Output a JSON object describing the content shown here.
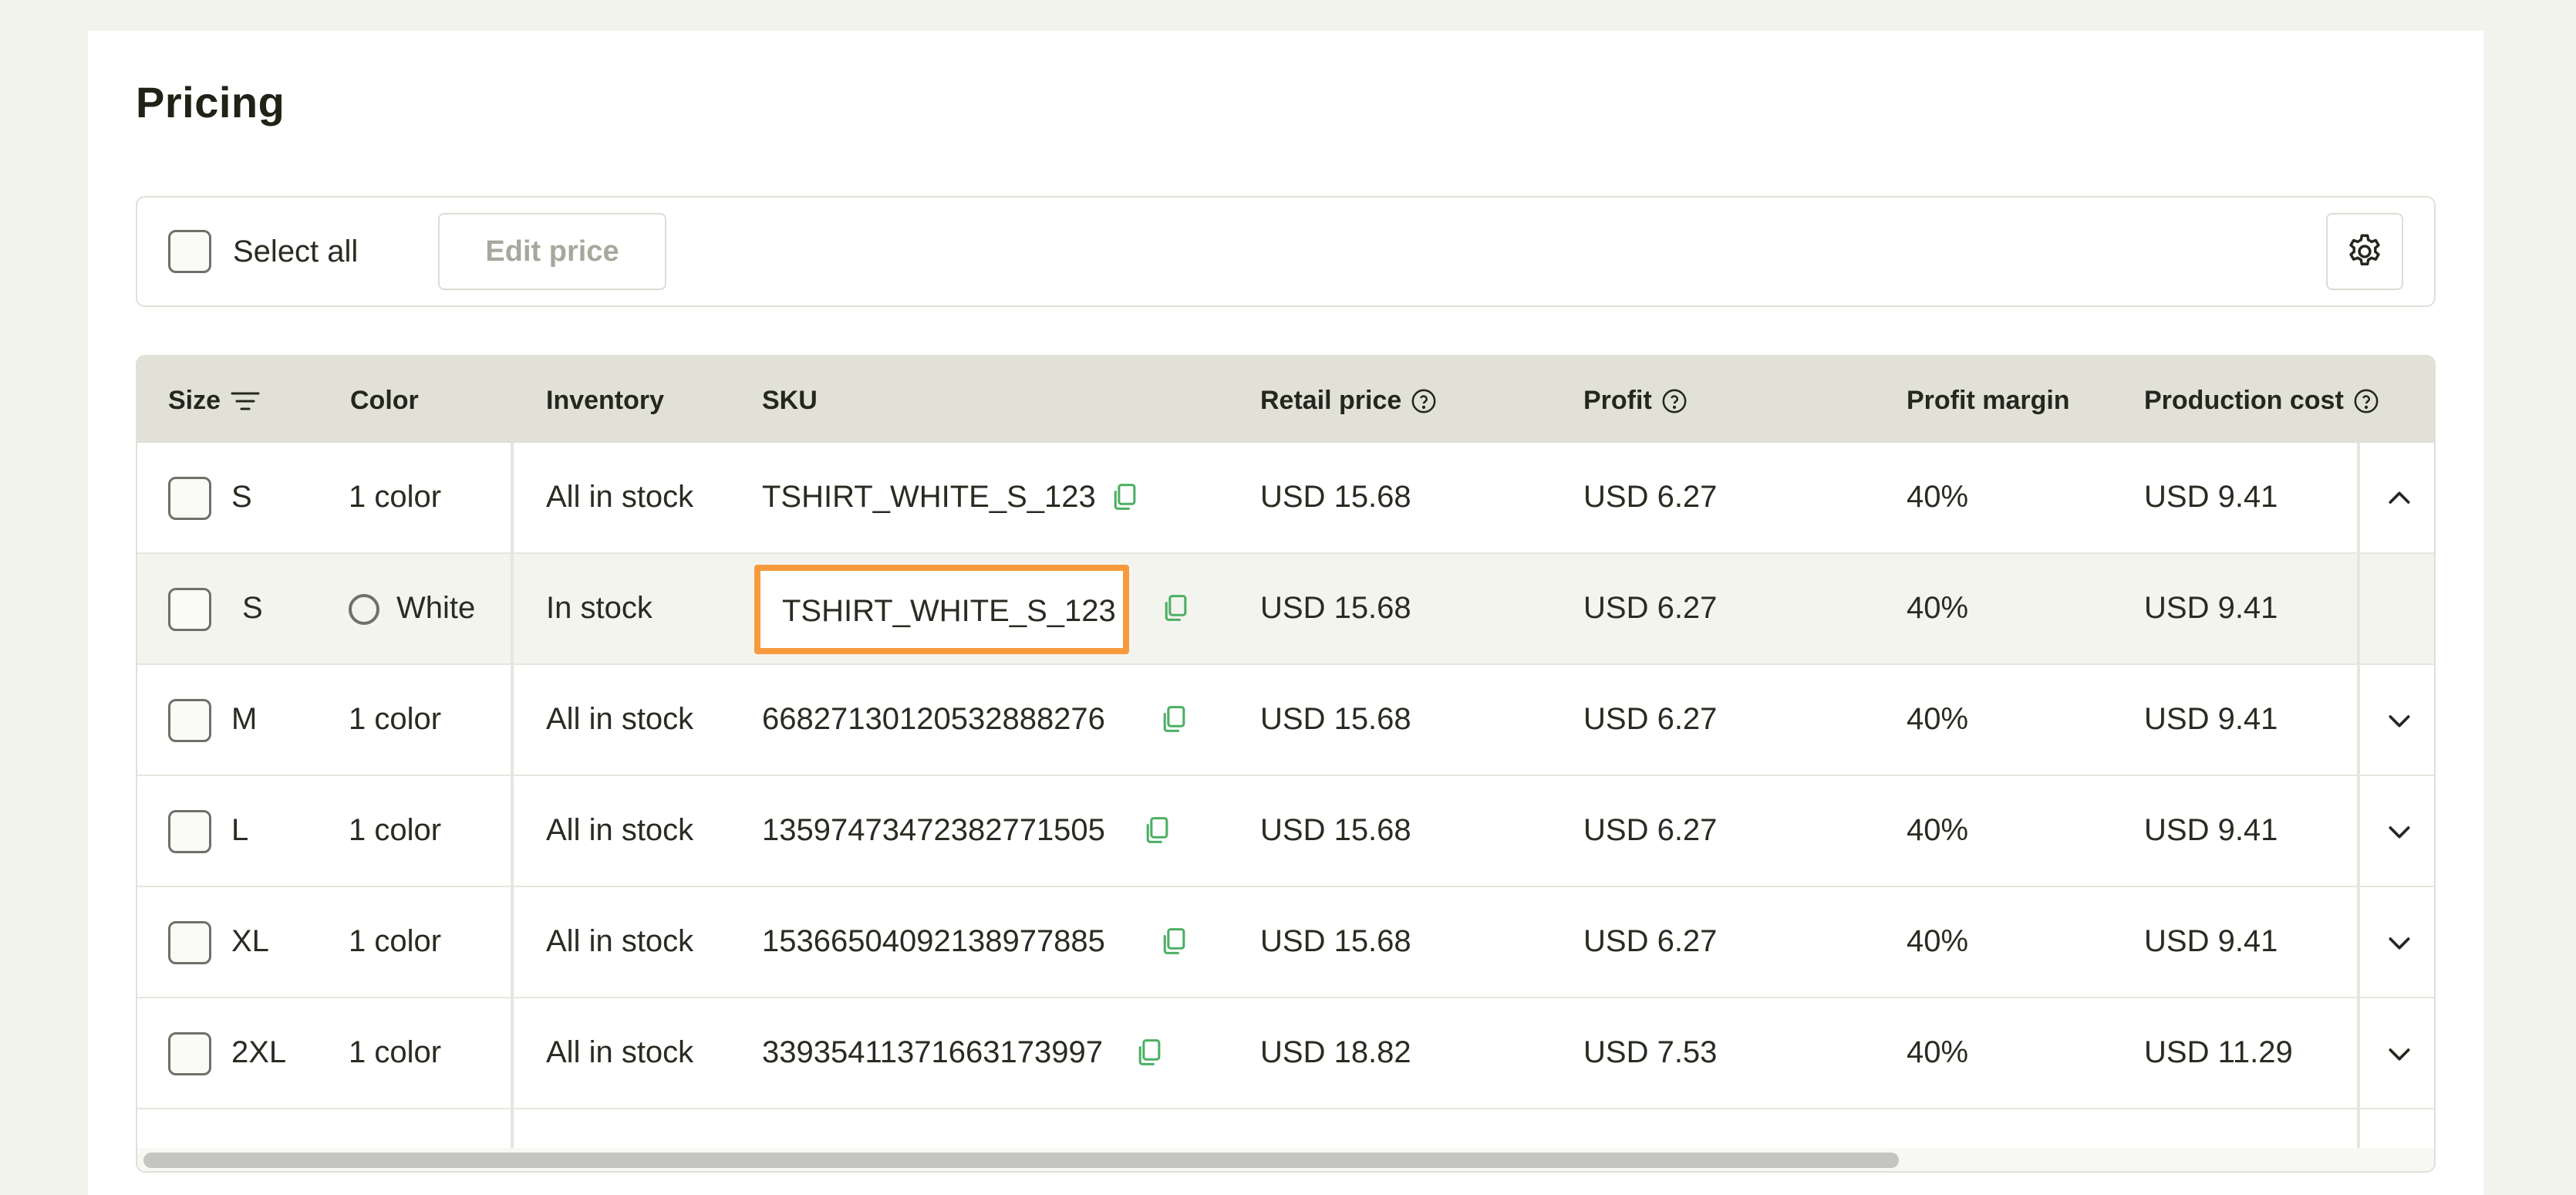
{
  "page": {
    "title": "Pricing"
  },
  "toolbar": {
    "select_all_label": "Select all",
    "edit_price_label": "Edit price",
    "settings_icon": "gear-icon"
  },
  "table": {
    "headers": {
      "size": "Size",
      "color": "Color",
      "inventory": "Inventory",
      "sku": "SKU",
      "retail_price": "Retail price",
      "profit": "Profit",
      "profit_margin": "Profit margin",
      "production_cost": "Production cost"
    },
    "rows": [
      {
        "size": "S",
        "color": "1 color",
        "inventory": "All in stock",
        "sku": "TSHIRT_WHITE_S_123",
        "retail": "USD 15.68",
        "profit": "USD 6.27",
        "margin": "40%",
        "cost": "USD 9.41",
        "expanded": true
      },
      {
        "size": "S",
        "color": "White",
        "inventory": "In stock",
        "sku": "TSHIRT_WHITE_S_123",
        "retail": "USD 15.68",
        "profit": "USD 6.27",
        "margin": "40%",
        "cost": "USD 9.41",
        "variant": true
      },
      {
        "size": "M",
        "color": "1 color",
        "inventory": "All in stock",
        "sku": "66827130120532888276",
        "retail": "USD 15.68",
        "profit": "USD 6.27",
        "margin": "40%",
        "cost": "USD 9.41"
      },
      {
        "size": "L",
        "color": "1 color",
        "inventory": "All in stock",
        "sku": "13597473472382771505",
        "retail": "USD 15.68",
        "profit": "USD 6.27",
        "margin": "40%",
        "cost": "USD 9.41"
      },
      {
        "size": "XL",
        "color": "1 color",
        "inventory": "All in stock",
        "sku": "15366504092138977885",
        "retail": "USD 15.68",
        "profit": "USD 6.27",
        "margin": "40%",
        "cost": "USD 9.41"
      },
      {
        "size": "2XL",
        "color": "1 color",
        "inventory": "All in stock",
        "sku": "33935411371663173997",
        "retail": "USD 18.82",
        "profit": "USD 7.53",
        "margin": "40%",
        "cost": "USD 11.29"
      }
    ]
  },
  "colors": {
    "highlight": "#f79a3e",
    "copy_icon": "#4caf63",
    "header_bg": "#e1e1d8"
  }
}
